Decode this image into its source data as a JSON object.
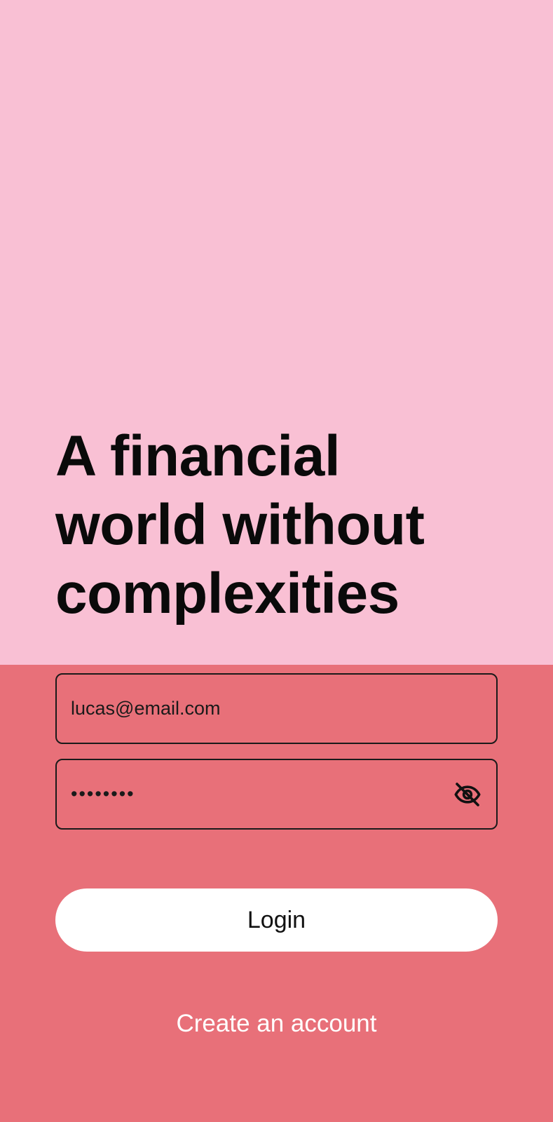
{
  "theme": {
    "hero_background": "#F9C0D4",
    "form_background": "#E87079",
    "text_dark": "#0a0a0a",
    "button_background": "#FFFFFF",
    "link_color": "#FFFFFF"
  },
  "hero": {
    "headline": "A financial\nworld without\ncomplexities"
  },
  "form": {
    "email_value": "lucas@email.com",
    "password_value": "••••••••",
    "password_toggle_icon": "eye-off-icon",
    "login_label": "Login",
    "create_account_label": "Create an account"
  }
}
